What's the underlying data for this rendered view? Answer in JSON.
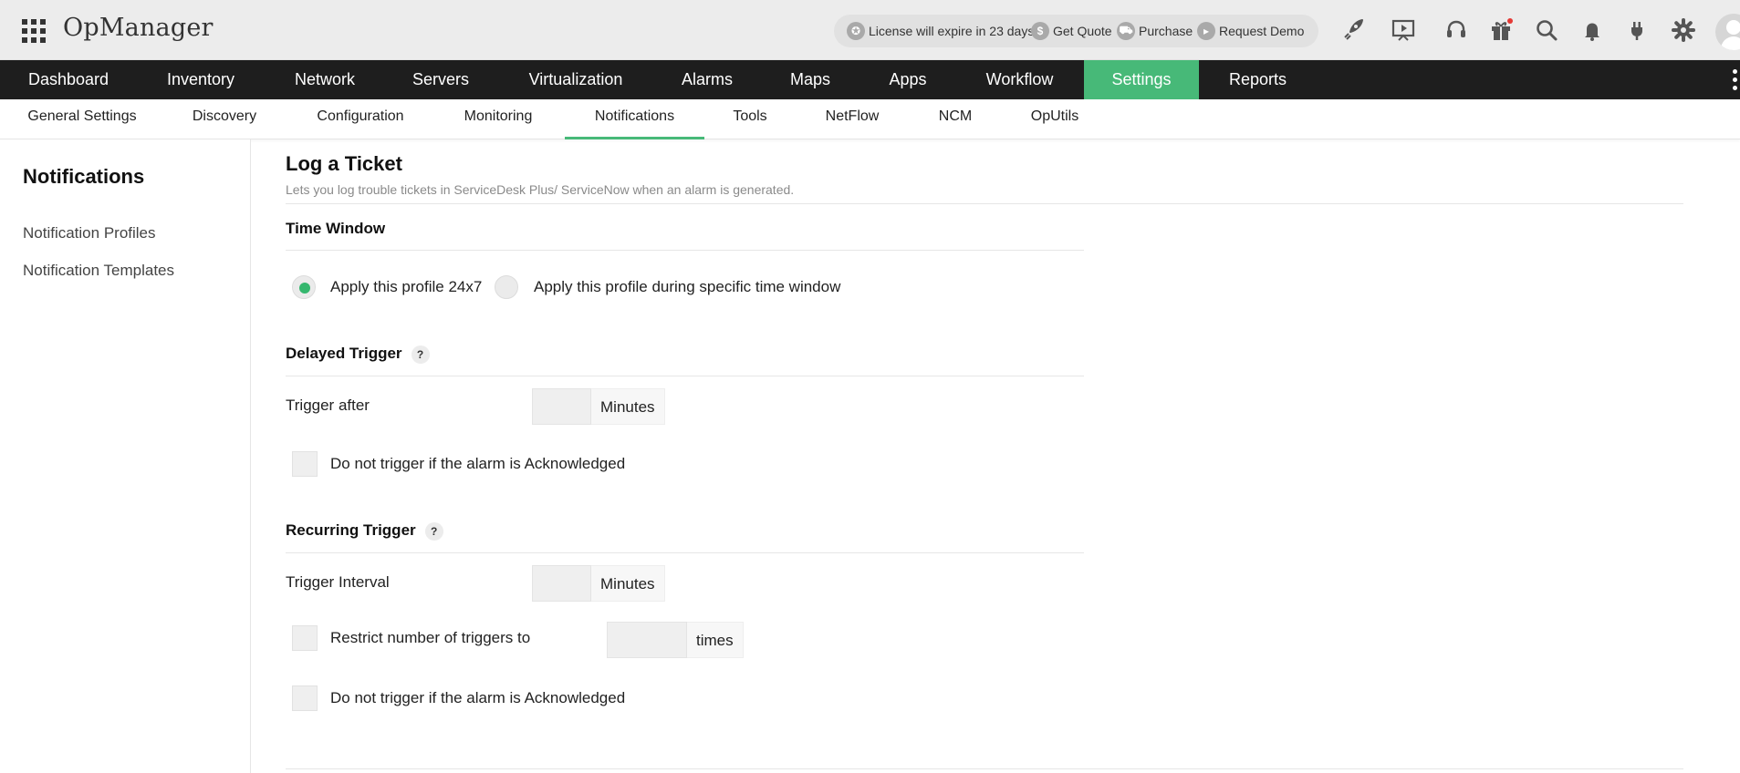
{
  "header": {
    "app_name": "OpManager",
    "license_text": "License will expire in 23 days",
    "get_quote": "Get Quote",
    "purchase": "Purchase",
    "request_demo": "Request Demo",
    "icons": [
      "rocket-icon",
      "presentation-icon",
      "headset-icon",
      "gift-icon",
      "search-icon",
      "bell-icon",
      "plug-icon",
      "gear-icon",
      "user-avatar"
    ]
  },
  "mainnav": {
    "items": [
      "Dashboard",
      "Inventory",
      "Network",
      "Servers",
      "Virtualization",
      "Alarms",
      "Maps",
      "Apps",
      "Workflow",
      "Settings",
      "Reports"
    ],
    "active": "Settings",
    "active_color": "#47b978"
  },
  "subnav": {
    "items": [
      "General Settings",
      "Discovery",
      "Configuration",
      "Monitoring",
      "Notifications",
      "Tools",
      "NetFlow",
      "NCM",
      "OpUtils"
    ],
    "active": "Notifications"
  },
  "sidebar": {
    "title": "Notifications",
    "items": [
      "Notification Profiles",
      "Notification Templates"
    ]
  },
  "main": {
    "title": "Log a Ticket",
    "description": "Lets you log trouble tickets in ServiceDesk Plus/ ServiceNow when an alarm is generated.",
    "time_window": {
      "title": "Time Window",
      "option_24x7": "Apply this profile 24x7",
      "option_specific": "Apply this profile during specific time window",
      "selected": "Apply this profile 24x7"
    },
    "delayed_trigger": {
      "title": "Delayed Trigger",
      "help": "?",
      "trigger_after_label": "Trigger after",
      "trigger_after_value": "",
      "unit": "Minutes",
      "ack_label": "Do not trigger if the alarm is Acknowledged",
      "ack_checked": false
    },
    "recurring_trigger": {
      "title": "Recurring Trigger",
      "help": "?",
      "interval_label": "Trigger Interval",
      "interval_value": "",
      "unit": "Minutes",
      "restrict_label": "Restrict number of triggers to",
      "restrict_value": "",
      "restrict_unit": "times",
      "restrict_checked": false,
      "ack_label": "Do not trigger if the alarm is Acknowledged",
      "ack_checked": false
    }
  }
}
